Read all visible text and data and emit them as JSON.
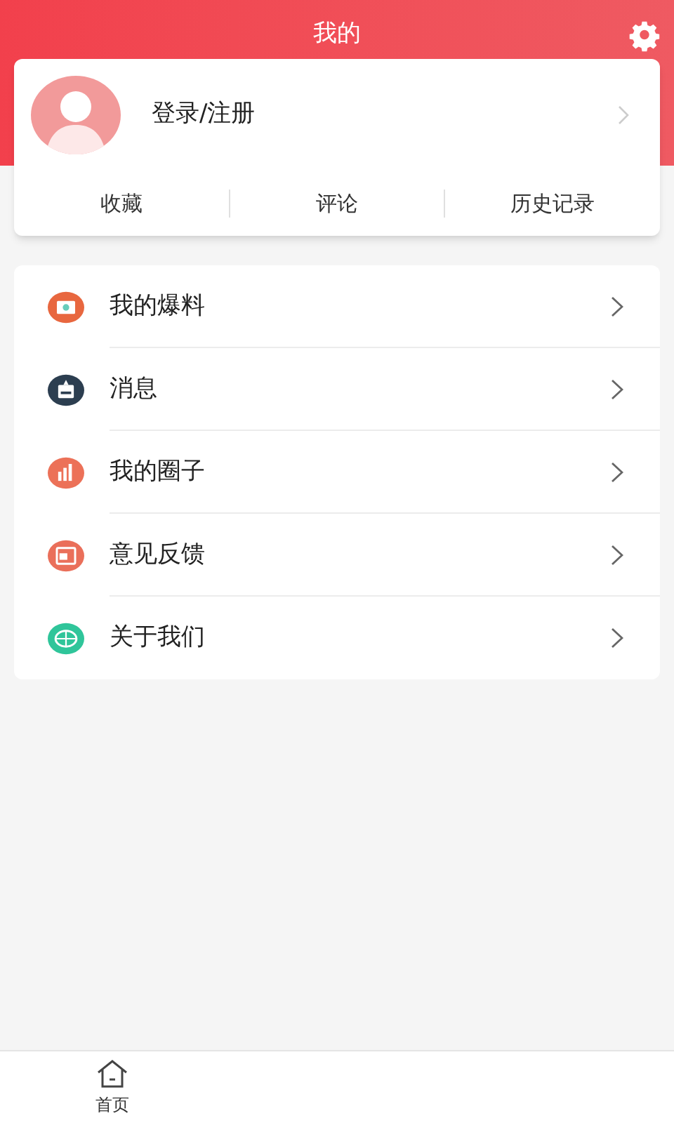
{
  "header": {
    "title": "我的"
  },
  "profile": {
    "login_label": "登录/注册"
  },
  "shortcuts": [
    "收藏",
    "评论",
    "历史记录"
  ],
  "menu": [
    {
      "label": "我的爆料",
      "kind": "camera",
      "color": "#e8673f"
    },
    {
      "label": "消息",
      "kind": "inbox",
      "color": "#2c3e50"
    },
    {
      "label": "我的圈子",
      "kind": "chart",
      "color": "#ec7158"
    },
    {
      "label": "意见反馈",
      "kind": "screen",
      "color": "#ea6f5a"
    },
    {
      "label": "关于我们",
      "kind": "globe",
      "color": "#2fc59a"
    }
  ],
  "tab_bar": [
    {
      "label": "首页",
      "kind": "home"
    }
  ]
}
